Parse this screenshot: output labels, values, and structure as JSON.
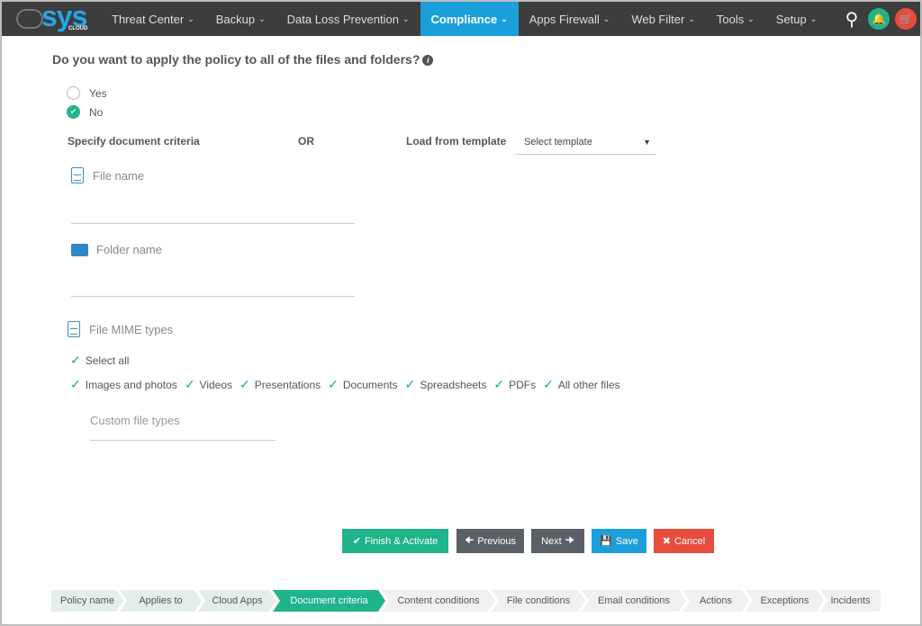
{
  "nav": {
    "logo": "SYS CLOUD",
    "items": [
      {
        "label": "Threat Center"
      },
      {
        "label": "Backup"
      },
      {
        "label": "Data Loss Prevention"
      },
      {
        "label": "Compliance",
        "active": true
      },
      {
        "label": "Apps Firewall"
      },
      {
        "label": "Web Filter"
      },
      {
        "label": "Tools"
      },
      {
        "label": "Setup"
      }
    ],
    "icons": [
      "search-icon",
      "bell-icon",
      "cart-icon"
    ],
    "bell_color": "#1fb48a",
    "cart_color": "#e74c3c"
  },
  "form": {
    "question": "Do you want to apply the policy to all of the files and folders?",
    "options": [
      {
        "label": "Yes",
        "selected": false
      },
      {
        "label": "No",
        "selected": true
      }
    ],
    "specify_label": "Specify document criteria",
    "or_label": "OR",
    "load_label": "Load from template",
    "template_select": {
      "value": "Select template"
    },
    "file_name_label": "File name",
    "file_name_value": "",
    "folder_name_label": "Folder name",
    "folder_name_value": "",
    "mime_label": "File MIME types",
    "select_all": {
      "label": "Select all",
      "checked": true
    },
    "mime_types": [
      {
        "label": "Images and photos",
        "checked": true
      },
      {
        "label": "Videos",
        "checked": true
      },
      {
        "label": "Presentations",
        "checked": true
      },
      {
        "label": "Documents",
        "checked": true
      },
      {
        "label": "Spreadsheets",
        "checked": true
      },
      {
        "label": "PDFs",
        "checked": true
      },
      {
        "label": "All other files",
        "checked": true
      }
    ],
    "custom_placeholder": "Custom file types"
  },
  "buttons": {
    "finish": "Finish & Activate",
    "previous": "Previous",
    "next": "Next",
    "save": "Save",
    "cancel": "Cancel"
  },
  "steps": [
    {
      "label": "Policy name"
    },
    {
      "label": "Applies to"
    },
    {
      "label": "Cloud Apps"
    },
    {
      "label": "Document criteria",
      "current": true
    },
    {
      "label": "Content conditions"
    },
    {
      "label": "File conditions"
    },
    {
      "label": "Email conditions"
    },
    {
      "label": "Actions"
    },
    {
      "label": "Exceptions"
    },
    {
      "label": "Incidents"
    }
  ],
  "colors": {
    "nav_bg": "#3d3d3d",
    "active_tab": "#1a9fdb",
    "primary_green": "#1fb48a",
    "grey_button": "#5a6066",
    "save_blue": "#1a9fdb",
    "cancel_red": "#e74c3c"
  }
}
